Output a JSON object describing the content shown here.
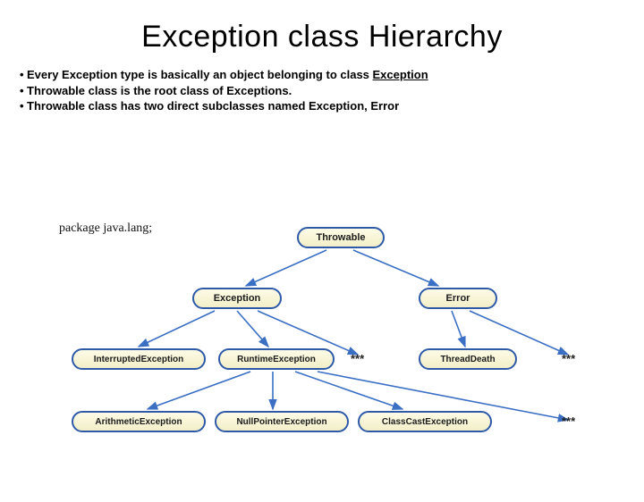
{
  "title": "Exception class Hierarchy",
  "bullets": {
    "b1a": "Every Exception type is basically an object belonging to class ",
    "b1b": "Exception",
    "b2a": "Throwable",
    "b2b": " class is the root class of Exceptions.",
    "b3a": "Throwable",
    "b3b": " class has two direct subclasses named Exception, Error"
  },
  "pkg_label": "package java.lang;",
  "nodes": {
    "throwable": "Throwable",
    "exception": "Exception",
    "error": "Error",
    "interrupted": "InterruptedException",
    "runtime": "RuntimeException",
    "threaddeath": "ThreadDeath",
    "arithmetic": "ArithmeticException",
    "nullpointer": "NullPointerException",
    "classcast": "ClassCastException"
  },
  "ellipsis": "***",
  "colors": {
    "node_border": "#2e5aa8",
    "node_fill_top": "#fdfbe6",
    "node_fill_bottom": "#f3efc9",
    "edge": "#3a6fc4"
  },
  "chart_data": {
    "type": "tree",
    "root": "Throwable",
    "edges": [
      [
        "Throwable",
        "Exception"
      ],
      [
        "Throwable",
        "Error"
      ],
      [
        "Exception",
        "InterruptedException"
      ],
      [
        "Exception",
        "RuntimeException"
      ],
      [
        "Exception",
        "***"
      ],
      [
        "Error",
        "ThreadDeath"
      ],
      [
        "Error",
        "***"
      ],
      [
        "RuntimeException",
        "ArithmeticException"
      ],
      [
        "RuntimeException",
        "NullPointerException"
      ],
      [
        "RuntimeException",
        "ClassCastException"
      ],
      [
        "RuntimeException",
        "***"
      ]
    ]
  }
}
